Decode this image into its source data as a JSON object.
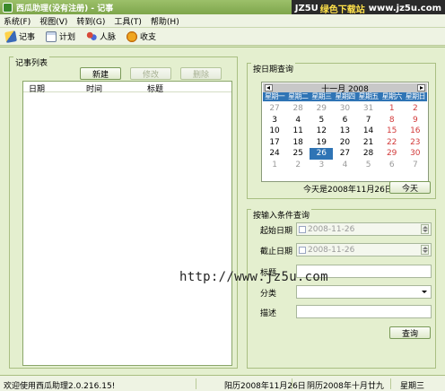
{
  "window": {
    "title": "西瓜助理(没有注册) - 记事",
    "watermark": {
      "site_name": "JZ5U",
      "text": "绿色下载站",
      "url": "www.jz5u.com"
    }
  },
  "menu": [
    "系统(F)",
    "视图(V)",
    "转到(G)",
    "工具(T)",
    "帮助(H)"
  ],
  "toolbar": [
    {
      "label": "记事",
      "icon": "pen-icon"
    },
    {
      "label": "计划",
      "icon": "document-icon"
    },
    {
      "label": "人脉",
      "icon": "people-icon"
    },
    {
      "label": "收支",
      "icon": "coin-icon"
    }
  ],
  "notes_panel": {
    "title": "记事列表",
    "buttons": {
      "new": "新建",
      "edit": "修改",
      "delete": "删除"
    },
    "columns": [
      "日期",
      "时间",
      "标题"
    ],
    "rows": []
  },
  "date_query": {
    "title": "按日期查询",
    "calendar": {
      "month_label": "十一月 2008",
      "weekdays": [
        "星期一",
        "星期二",
        "星期三",
        "星期四",
        "星期五",
        "星期六",
        "星期日"
      ],
      "weeks": [
        [
          "27",
          "28",
          "29",
          "30",
          "31",
          "1",
          "2"
        ],
        [
          "3",
          "4",
          "5",
          "6",
          "7",
          "8",
          "9"
        ],
        [
          "10",
          "11",
          "12",
          "13",
          "14",
          "15",
          "16"
        ],
        [
          "17",
          "18",
          "19",
          "20",
          "21",
          "22",
          "23"
        ],
        [
          "24",
          "25",
          "26",
          "27",
          "28",
          "29",
          "30"
        ],
        [
          "1",
          "2",
          "3",
          "4",
          "5",
          "6",
          "7"
        ]
      ],
      "selected": "26"
    },
    "today_text": "今天是2008年11月26日",
    "today_button": "今天"
  },
  "condition_query": {
    "title": "按输入条件查询",
    "start_date": {
      "label": "起始日期",
      "value": "2008-11-26"
    },
    "end_date": {
      "label": "截止日期",
      "value": "2008-11-26"
    },
    "title_field": {
      "label": "标题",
      "value": ""
    },
    "category": {
      "label": "分类",
      "value": ""
    },
    "description": {
      "label": "描述",
      "value": ""
    },
    "query_button": "查询",
    "url_watermark": "http://www.jz5u.com"
  },
  "status": {
    "welcome": "欢迎使用西瓜助理2.0.216.15!",
    "solar_date": "阳历2008年11月26日",
    "lunar_date": "阴历2008年十月廿九",
    "weekday": "星期三"
  }
}
